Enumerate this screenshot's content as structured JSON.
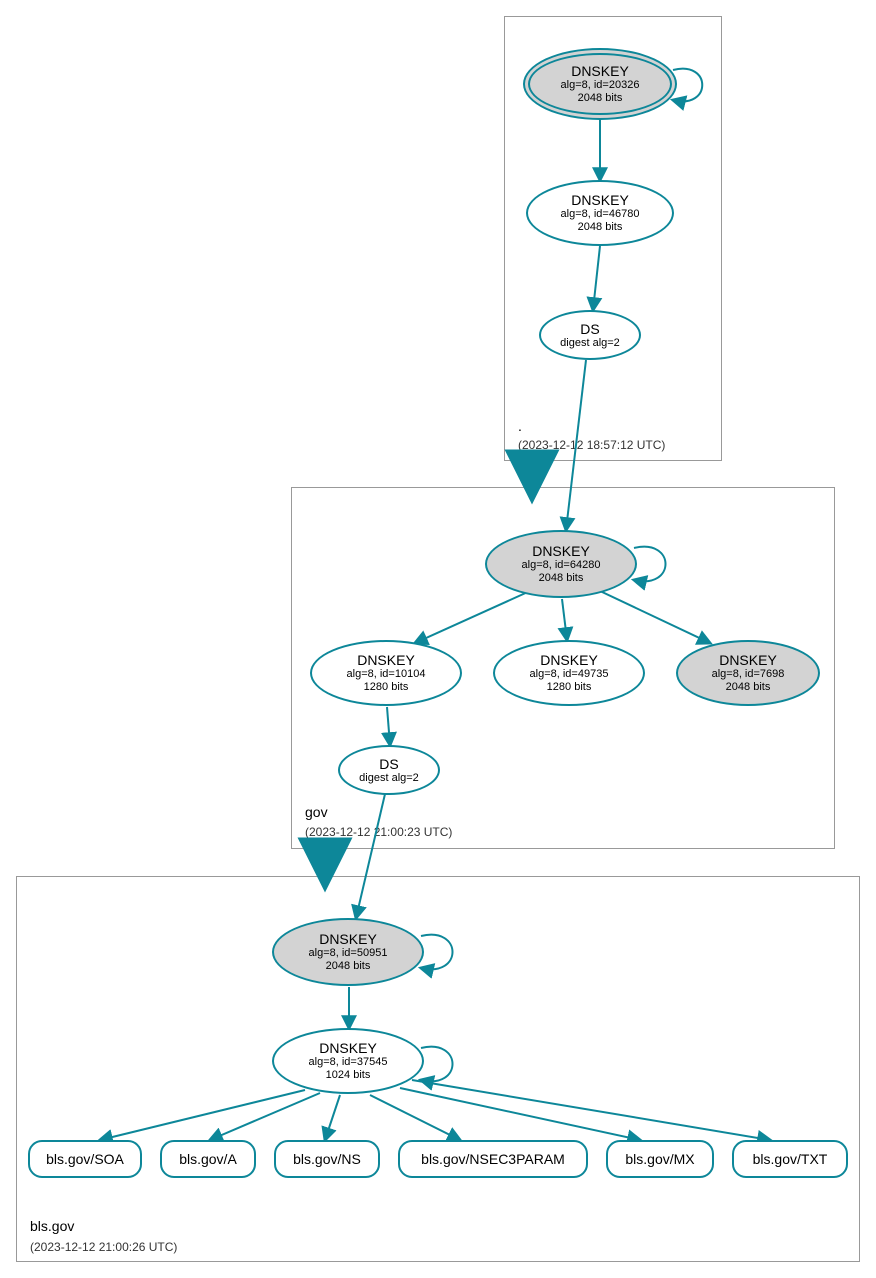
{
  "zones": {
    "root": {
      "label_name": ".",
      "timestamp": "(2023-12-12 18:57:12 UTC)"
    },
    "gov": {
      "label_name": "gov",
      "timestamp": "(2023-12-12 21:00:23 UTC)"
    },
    "bls": {
      "label_name": "bls.gov",
      "timestamp": "(2023-12-12 21:00:26 UTC)"
    }
  },
  "nodes": {
    "root_ksk": {
      "title": "DNSKEY",
      "sub1": "alg=8, id=20326",
      "sub2": "2048 bits"
    },
    "root_zsk": {
      "title": "DNSKEY",
      "sub1": "alg=8, id=46780",
      "sub2": "2048 bits"
    },
    "root_ds": {
      "title": "DS",
      "sub1": "digest alg=2"
    },
    "gov_ksk": {
      "title": "DNSKEY",
      "sub1": "alg=8, id=64280",
      "sub2": "2048 bits"
    },
    "gov_zsk1": {
      "title": "DNSKEY",
      "sub1": "alg=8, id=10104",
      "sub2": "1280 bits"
    },
    "gov_zsk2": {
      "title": "DNSKEY",
      "sub1": "alg=8, id=49735",
      "sub2": "1280 bits"
    },
    "gov_ksk2": {
      "title": "DNSKEY",
      "sub1": "alg=8, id=7698",
      "sub2": "2048 bits"
    },
    "gov_ds": {
      "title": "DS",
      "sub1": "digest alg=2"
    },
    "bls_ksk": {
      "title": "DNSKEY",
      "sub1": "alg=8, id=50951",
      "sub2": "2048 bits"
    },
    "bls_zsk": {
      "title": "DNSKEY",
      "sub1": "alg=8, id=37545",
      "sub2": "1024 bits"
    },
    "rr_soa": {
      "label": "bls.gov/SOA"
    },
    "rr_a": {
      "label": "bls.gov/A"
    },
    "rr_ns": {
      "label": "bls.gov/NS"
    },
    "rr_nsec3": {
      "label": "bls.gov/NSEC3PARAM"
    },
    "rr_mx": {
      "label": "bls.gov/MX"
    },
    "rr_txt": {
      "label": "bls.gov/TXT"
    }
  }
}
